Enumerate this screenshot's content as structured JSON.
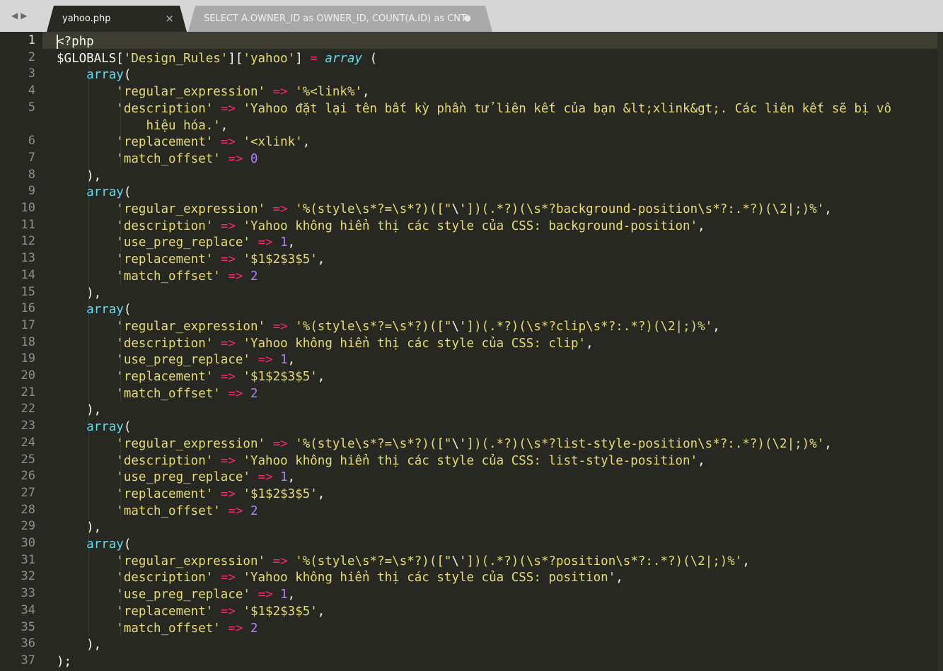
{
  "tabs": [
    {
      "label": "yahoo.php",
      "active": true,
      "close_glyph": "×"
    },
    {
      "label": "SELECT A.OWNER_ID as OWNER_ID, COUNT(A.ID) as CNT",
      "active": false,
      "dirty_glyph": "●"
    }
  ],
  "nav": {
    "back": "◀",
    "forward": "▶"
  },
  "gutter": [
    "1",
    "2",
    "3",
    "4",
    "5",
    "",
    "6",
    "7",
    "8",
    "9",
    "10",
    "11",
    "12",
    "13",
    "14",
    "15",
    "16",
    "17",
    "18",
    "19",
    "20",
    "21",
    "22",
    "23",
    "24",
    "25",
    "26",
    "27",
    "28",
    "29",
    "30",
    "31",
    "32",
    "33",
    "34",
    "35",
    "36",
    "37"
  ],
  "code": [
    {
      "tokens": [
        [
          "v",
          "<?php"
        ]
      ]
    },
    {
      "tokens": [
        [
          "v",
          "$GLOBALS["
        ],
        [
          "s",
          "'Design_Rules'"
        ],
        [
          "v",
          "]["
        ],
        [
          "s",
          "'yahoo'"
        ],
        [
          "v",
          "] "
        ],
        [
          "k",
          "="
        ],
        [
          "v",
          " "
        ],
        [
          "fi",
          "array"
        ],
        [
          "v",
          " ("
        ]
      ]
    },
    {
      "tokens": [
        [
          "v",
          "    "
        ],
        [
          "f",
          "array"
        ],
        [
          "v",
          "("
        ]
      ]
    },
    {
      "tokens": [
        [
          "v",
          "        "
        ],
        [
          "s",
          "'regular_expression'"
        ],
        [
          "v",
          " "
        ],
        [
          "k",
          "=>"
        ],
        [
          "v",
          " "
        ],
        [
          "s",
          "'%<link%'"
        ],
        [
          "v",
          ","
        ]
      ]
    },
    {
      "tokens": [
        [
          "v",
          "        "
        ],
        [
          "s",
          "'description'"
        ],
        [
          "v",
          " "
        ],
        [
          "k",
          "=>"
        ],
        [
          "v",
          " "
        ],
        [
          "s",
          "'Yahoo đặt lại tên bất kỳ phần tử liên kết của bạn &lt;xlink&gt;. Các liên kết sẽ bị vô"
        ]
      ]
    },
    {
      "tokens": [
        [
          "v",
          "            "
        ],
        [
          "s",
          "hiệu hóa.'"
        ],
        [
          "v",
          ","
        ]
      ]
    },
    {
      "tokens": [
        [
          "v",
          "        "
        ],
        [
          "s",
          "'replacement'"
        ],
        [
          "v",
          " "
        ],
        [
          "k",
          "=>"
        ],
        [
          "v",
          " "
        ],
        [
          "s",
          "'<xlink'"
        ],
        [
          "v",
          ","
        ]
      ]
    },
    {
      "tokens": [
        [
          "v",
          "        "
        ],
        [
          "s",
          "'match_offset'"
        ],
        [
          "v",
          " "
        ],
        [
          "k",
          "=>"
        ],
        [
          "v",
          " "
        ],
        [
          "n",
          "0"
        ]
      ]
    },
    {
      "tokens": [
        [
          "v",
          "    ),"
        ]
      ]
    },
    {
      "tokens": [
        [
          "v",
          "    "
        ],
        [
          "f",
          "array"
        ],
        [
          "v",
          "("
        ]
      ]
    },
    {
      "tokens": [
        [
          "v",
          "        "
        ],
        [
          "s",
          "'regular_expression'"
        ],
        [
          "v",
          " "
        ],
        [
          "k",
          "=>"
        ],
        [
          "v",
          " "
        ],
        [
          "s",
          "'%(style\\s*?=\\s*?)([\""
        ],
        [
          "v",
          "\\'"
        ],
        [
          "s",
          "])(.*?)(\\s*?background-position\\s*?:.*?)(\\2|;)%'"
        ],
        [
          "v",
          ","
        ]
      ]
    },
    {
      "tokens": [
        [
          "v",
          "        "
        ],
        [
          "s",
          "'description'"
        ],
        [
          "v",
          " "
        ],
        [
          "k",
          "=>"
        ],
        [
          "v",
          " "
        ],
        [
          "s",
          "'Yahoo không hiển thị các style của CSS: background-position'"
        ],
        [
          "v",
          ","
        ]
      ]
    },
    {
      "tokens": [
        [
          "v",
          "        "
        ],
        [
          "s",
          "'use_preg_replace'"
        ],
        [
          "v",
          " "
        ],
        [
          "k",
          "=>"
        ],
        [
          "v",
          " "
        ],
        [
          "n",
          "1"
        ],
        [
          "v",
          ","
        ]
      ]
    },
    {
      "tokens": [
        [
          "v",
          "        "
        ],
        [
          "s",
          "'replacement'"
        ],
        [
          "v",
          " "
        ],
        [
          "k",
          "=>"
        ],
        [
          "v",
          " "
        ],
        [
          "s",
          "'$1$2$3$5'"
        ],
        [
          "v",
          ","
        ]
      ]
    },
    {
      "tokens": [
        [
          "v",
          "        "
        ],
        [
          "s",
          "'match_offset'"
        ],
        [
          "v",
          " "
        ],
        [
          "k",
          "=>"
        ],
        [
          "v",
          " "
        ],
        [
          "n",
          "2"
        ]
      ]
    },
    {
      "tokens": [
        [
          "v",
          "    ),"
        ]
      ]
    },
    {
      "tokens": [
        [
          "v",
          "    "
        ],
        [
          "f",
          "array"
        ],
        [
          "v",
          "("
        ]
      ]
    },
    {
      "tokens": [
        [
          "v",
          "        "
        ],
        [
          "s",
          "'regular_expression'"
        ],
        [
          "v",
          " "
        ],
        [
          "k",
          "=>"
        ],
        [
          "v",
          " "
        ],
        [
          "s",
          "'%(style\\s*?=\\s*?)([\""
        ],
        [
          "v",
          "\\'"
        ],
        [
          "s",
          "])(.*?)(\\s*?clip\\s*?:.*?)(\\2|;)%'"
        ],
        [
          "v",
          ","
        ]
      ]
    },
    {
      "tokens": [
        [
          "v",
          "        "
        ],
        [
          "s",
          "'description'"
        ],
        [
          "v",
          " "
        ],
        [
          "k",
          "=>"
        ],
        [
          "v",
          " "
        ],
        [
          "s",
          "'Yahoo không hiển thị các style của CSS: clip'"
        ],
        [
          "v",
          ","
        ]
      ]
    },
    {
      "tokens": [
        [
          "v",
          "        "
        ],
        [
          "s",
          "'use_preg_replace'"
        ],
        [
          "v",
          " "
        ],
        [
          "k",
          "=>"
        ],
        [
          "v",
          " "
        ],
        [
          "n",
          "1"
        ],
        [
          "v",
          ","
        ]
      ]
    },
    {
      "tokens": [
        [
          "v",
          "        "
        ],
        [
          "s",
          "'replacement'"
        ],
        [
          "v",
          " "
        ],
        [
          "k",
          "=>"
        ],
        [
          "v",
          " "
        ],
        [
          "s",
          "'$1$2$3$5'"
        ],
        [
          "v",
          ","
        ]
      ]
    },
    {
      "tokens": [
        [
          "v",
          "        "
        ],
        [
          "s",
          "'match_offset'"
        ],
        [
          "v",
          " "
        ],
        [
          "k",
          "=>"
        ],
        [
          "v",
          " "
        ],
        [
          "n",
          "2"
        ]
      ]
    },
    {
      "tokens": [
        [
          "v",
          "    ),"
        ]
      ]
    },
    {
      "tokens": [
        [
          "v",
          "    "
        ],
        [
          "f",
          "array"
        ],
        [
          "v",
          "("
        ]
      ]
    },
    {
      "tokens": [
        [
          "v",
          "        "
        ],
        [
          "s",
          "'regular_expression'"
        ],
        [
          "v",
          " "
        ],
        [
          "k",
          "=>"
        ],
        [
          "v",
          " "
        ],
        [
          "s",
          "'%(style\\s*?=\\s*?)([\""
        ],
        [
          "v",
          "\\'"
        ],
        [
          "s",
          "])(.*?)(\\s*?list-style-position\\s*?:.*?)(\\2|;)%'"
        ],
        [
          "v",
          ","
        ]
      ]
    },
    {
      "tokens": [
        [
          "v",
          "        "
        ],
        [
          "s",
          "'description'"
        ],
        [
          "v",
          " "
        ],
        [
          "k",
          "=>"
        ],
        [
          "v",
          " "
        ],
        [
          "s",
          "'Yahoo không hiển thị các style của CSS: list-style-position'"
        ],
        [
          "v",
          ","
        ]
      ]
    },
    {
      "tokens": [
        [
          "v",
          "        "
        ],
        [
          "s",
          "'use_preg_replace'"
        ],
        [
          "v",
          " "
        ],
        [
          "k",
          "=>"
        ],
        [
          "v",
          " "
        ],
        [
          "n",
          "1"
        ],
        [
          "v",
          ","
        ]
      ]
    },
    {
      "tokens": [
        [
          "v",
          "        "
        ],
        [
          "s",
          "'replacement'"
        ],
        [
          "v",
          " "
        ],
        [
          "k",
          "=>"
        ],
        [
          "v",
          " "
        ],
        [
          "s",
          "'$1$2$3$5'"
        ],
        [
          "v",
          ","
        ]
      ]
    },
    {
      "tokens": [
        [
          "v",
          "        "
        ],
        [
          "s",
          "'match_offset'"
        ],
        [
          "v",
          " "
        ],
        [
          "k",
          "=>"
        ],
        [
          "v",
          " "
        ],
        [
          "n",
          "2"
        ]
      ]
    },
    {
      "tokens": [
        [
          "v",
          "    ),"
        ]
      ]
    },
    {
      "tokens": [
        [
          "v",
          "    "
        ],
        [
          "f",
          "array"
        ],
        [
          "v",
          "("
        ]
      ]
    },
    {
      "tokens": [
        [
          "v",
          "        "
        ],
        [
          "s",
          "'regular_expression'"
        ],
        [
          "v",
          " "
        ],
        [
          "k",
          "=>"
        ],
        [
          "v",
          " "
        ],
        [
          "s",
          "'%(style\\s*?=\\s*?)([\""
        ],
        [
          "v",
          "\\'"
        ],
        [
          "s",
          "])(.*?)(\\s*?position\\s*?:.*?)(\\2|;)%'"
        ],
        [
          "v",
          ","
        ]
      ]
    },
    {
      "tokens": [
        [
          "v",
          "        "
        ],
        [
          "s",
          "'description'"
        ],
        [
          "v",
          " "
        ],
        [
          "k",
          "=>"
        ],
        [
          "v",
          " "
        ],
        [
          "s",
          "'Yahoo không hiển thị các style của CSS: position'"
        ],
        [
          "v",
          ","
        ]
      ]
    },
    {
      "tokens": [
        [
          "v",
          "        "
        ],
        [
          "s",
          "'use_preg_replace'"
        ],
        [
          "v",
          " "
        ],
        [
          "k",
          "=>"
        ],
        [
          "v",
          " "
        ],
        [
          "n",
          "1"
        ],
        [
          "v",
          ","
        ]
      ]
    },
    {
      "tokens": [
        [
          "v",
          "        "
        ],
        [
          "s",
          "'replacement'"
        ],
        [
          "v",
          " "
        ],
        [
          "k",
          "=>"
        ],
        [
          "v",
          " "
        ],
        [
          "s",
          "'$1$2$3$5'"
        ],
        [
          "v",
          ","
        ]
      ]
    },
    {
      "tokens": [
        [
          "v",
          "        "
        ],
        [
          "s",
          "'match_offset'"
        ],
        [
          "v",
          " "
        ],
        [
          "k",
          "=>"
        ],
        [
          "v",
          " "
        ],
        [
          "n",
          "2"
        ]
      ]
    },
    {
      "tokens": [
        [
          "v",
          "    ),"
        ]
      ]
    },
    {
      "tokens": [
        [
          "v",
          ");"
        ]
      ]
    }
  ],
  "colors": {
    "background": "#272822",
    "string": "#e6db74",
    "keyword": "#f92672",
    "number": "#ae81ff",
    "function": "#66d9ef"
  }
}
